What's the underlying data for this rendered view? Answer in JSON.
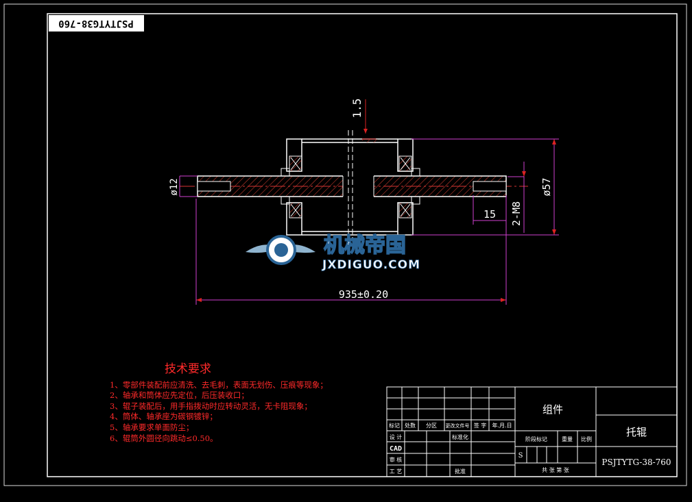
{
  "drawing_code_rotated": "PSJTYTG38-760",
  "dims": {
    "gap": "1.5",
    "shaft_dia": "ø12",
    "tube_dia": "ø57",
    "thread": "2-M8",
    "thread_depth": "15",
    "length": "935±0.20"
  },
  "watermark": {
    "cn": "机械帝国",
    "en": "JXDIGUO.COM"
  },
  "tech": {
    "title": "技术要求",
    "items": [
      "1、零部件装配前应清洗、去毛刺，表面无划伤、压痕等现象；",
      "2、轴承和筒体应先定位，后压装收口；",
      "3、辊子装配后，用手指拨动时应转动灵活，无卡阻现象；",
      "4、筒体、轴承座为碳钢镀锌；",
      "5、轴承要求单面防尘；",
      "6、辊筒外圆径向跳动≤0.50。"
    ]
  },
  "titleblock": {
    "h_mark": "标记",
    "h_count": "处数",
    "h_zone": "分区",
    "h_docno": "更改文件号",
    "h_sign": "签 字",
    "h_date": "年.月.日",
    "r_design": "设 计",
    "r_std": "标准化",
    "cad": "CAD",
    "r_review": "审 核",
    "r_process": "工 艺",
    "r_approve": "批准",
    "assembly": "组件",
    "stage": "阶段标记",
    "weight": "重量",
    "scale": "比例",
    "s": "S",
    "sheets": "共    张   第    张",
    "part_name": "托辊",
    "part_code": "PSJTYTG-38-760"
  }
}
